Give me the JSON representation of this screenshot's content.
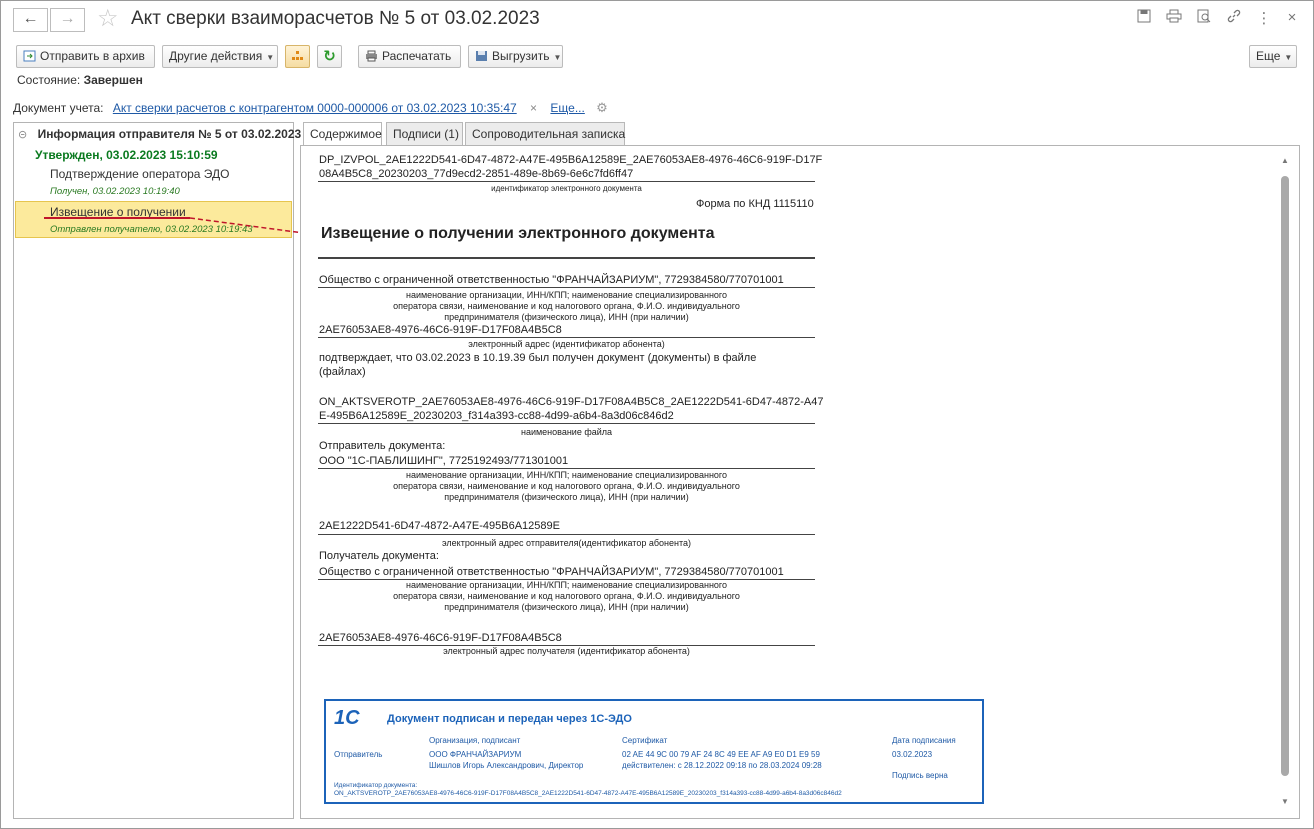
{
  "window": {
    "title": "Акт сверки взаиморасчетов № 5 от 03.02.2023"
  },
  "toolbar": {
    "archive": "Отправить в архив",
    "other_actions": "Другие действия",
    "print": "Распечатать",
    "export": "Выгрузить",
    "more": "Еще"
  },
  "state": {
    "label": "Состояние:",
    "value": "Завершен"
  },
  "doc_account": {
    "label": "Документ учета:",
    "link": "Акт сверки расчетов с контрагентом 0000-000006 от 03.02.2023 10:35:47",
    "close": "×",
    "more": "Еще..."
  },
  "tree": {
    "root": "Информация отправителя № 5 от 03.02.2023",
    "approved": "Утвержден, 03.02.2023 15:10:59",
    "items": [
      {
        "label": "Подтверждение оператора ЭДО",
        "sub": "Получен, 03.02.2023 10:19:40"
      },
      {
        "label": "Извещение о получении",
        "sub": "Отправлен получателю, 03.02.2023 10:19:43"
      }
    ]
  },
  "tabs": [
    "Содержимое",
    "Подписи (1)",
    "Сопроводительная записка"
  ],
  "document": {
    "file_id_1": "DP_IZVPOL_2AE1222D541-6D47-4872-A47E-495B6A12589E_2AE76053AE8-4976-46C6-919F-D17F",
    "file_id_2": "08A4B5C8_20230203_77d9ecd2-2851-489e-8b69-6e6c7fd6ff47",
    "cap_id": "идентификатор электронного документа",
    "form": "Форма по КНД 1115110",
    "heading": "Извещение о получении электронного документа",
    "org": "Общество с ограниченной ответственностью \"ФРАНЧАЙЗАРИУМ\", 7729384580/770701001",
    "cap_org_1": "наименование организации, ИНН/КПП; наименование специализированного",
    "cap_org_2": "оператора связи, наименование и код налогового органа, Ф.И.О. индивидуального",
    "cap_org_3": "предпринимателя (физического лица), ИНН (при наличии)",
    "addr": "2AE76053AE8-4976-46C6-919F-D17F08A4B5C8",
    "cap_addr": "электронный адрес (идентификатор абонента)",
    "confirm_1": "подтверждает, что 03.02.2023 в 10.19.39 был получен документ (документы) в файле",
    "confirm_2": "(файлах)",
    "fname_1": "ON_AKTSVEROTP_2AE76053AE8-4976-46C6-919F-D17F08A4B5C8_2AE1222D541-6D47-4872-A47",
    "fname_2": "E-495B6A12589E_20230203_f314a393-cc88-4d99-a6b4-8a3d06c846d2",
    "cap_fname": "наименование файла",
    "sender_label": "Отправитель документа:",
    "sender": "ООО \"1С-ПАБЛИШИНГ\", 7725192493/771301001",
    "cap_s1": "наименование организации, ИНН/КПП; наименование специализированного",
    "cap_s2": "оператора связи, наименование и код налогового органа, Ф.И.О. индивидуального",
    "cap_s3": "предпринимателя (физического лица), ИНН (при наличии)",
    "sender_addr": "2AE1222D541-6D47-4872-A47E-495B6A12589E",
    "cap_sender_addr": "электронный адрес отправителя(идентификатор абонента)",
    "recipient_label": "Получатель документа:",
    "recipient": "Общество с ограниченной ответственностью \"ФРАНЧАЙЗАРИУМ\", 7729384580/770701001",
    "cap_r1": "наименование организации, ИНН/КПП; наименование специализированного",
    "cap_r2": "оператора связи, наименование и код налогового органа, Ф.И.О. индивидуального",
    "cap_r3": "предпринимателя (физического лица), ИНН (при наличии)",
    "recipient_addr": "2AE76053AE8-4976-46C6-919F-D17F08A4B5C8",
    "cap_recipient_addr": "электронный адрес получателя (идентификатор абонента)"
  },
  "stamp": {
    "logo": "1С",
    "title": "Документ подписан и передан через 1С-ЭДО",
    "sender": "Отправитель",
    "org_head": "Организация, подписант",
    "org": "ООО ФРАНЧАЙЗАРИУМ",
    "signer": "Шишлов Игорь Александрович, Директор",
    "cert_head": "Сертификат",
    "cert": "02 AE 44 9C 00 79 AF 24 8C 49 EE AF A9 E0 D1 E9 59",
    "cert_valid": "действителен: с 28.12.2022 09:18 по 28.03.2024 09:28",
    "date_head": "Дата подписания",
    "date": "03.02.2023",
    "sig_ok": "Подпись верна",
    "id_label": "Идентификатор документа:",
    "id": "ON_AKTSVEROTP_2AE76053AE8-4976-46C6-919F-D17F08A4B5C8_2AE1222D541-6D47-4872-A47E-495B6A12589E_20230203_f314a393-cc88-4d99-a6b4-8a3d06c846d2"
  }
}
